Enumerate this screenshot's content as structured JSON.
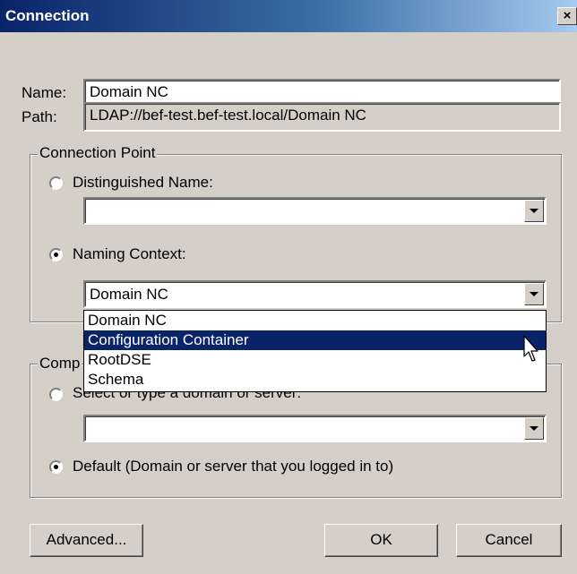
{
  "window": {
    "title": "Connection",
    "close_glyph": "×"
  },
  "name_field": {
    "label": "Name:",
    "value": "Domain NC"
  },
  "path_field": {
    "label": "Path:",
    "value": "LDAP://bef-test.bef-test.local/Domain NC"
  },
  "connection_point": {
    "legend": "Connection Point",
    "distinguished_name": {
      "label": "Distinguished Name:",
      "checked": false,
      "value": ""
    },
    "naming_context": {
      "label": "Naming Context:",
      "checked": true,
      "value": "Domain NC"
    },
    "dropdown_options": [
      "Domain NC",
      "Configuration Container",
      "RootDSE",
      "Schema"
    ],
    "selected_option_index": 1
  },
  "computer": {
    "legend_partial": "Comp",
    "select_label": "Select or type a domain or server:",
    "select_checked": false,
    "server_value": "",
    "default_label": "Default (Domain or server that you logged in to)",
    "default_checked": true
  },
  "buttons": {
    "advanced": "Advanced...",
    "ok": "OK",
    "cancel": "Cancel"
  },
  "colors": {
    "face": "#d4d0c8",
    "title_start": "#0a246a",
    "title_end": "#a6caf0",
    "selection": "#0a246a"
  }
}
